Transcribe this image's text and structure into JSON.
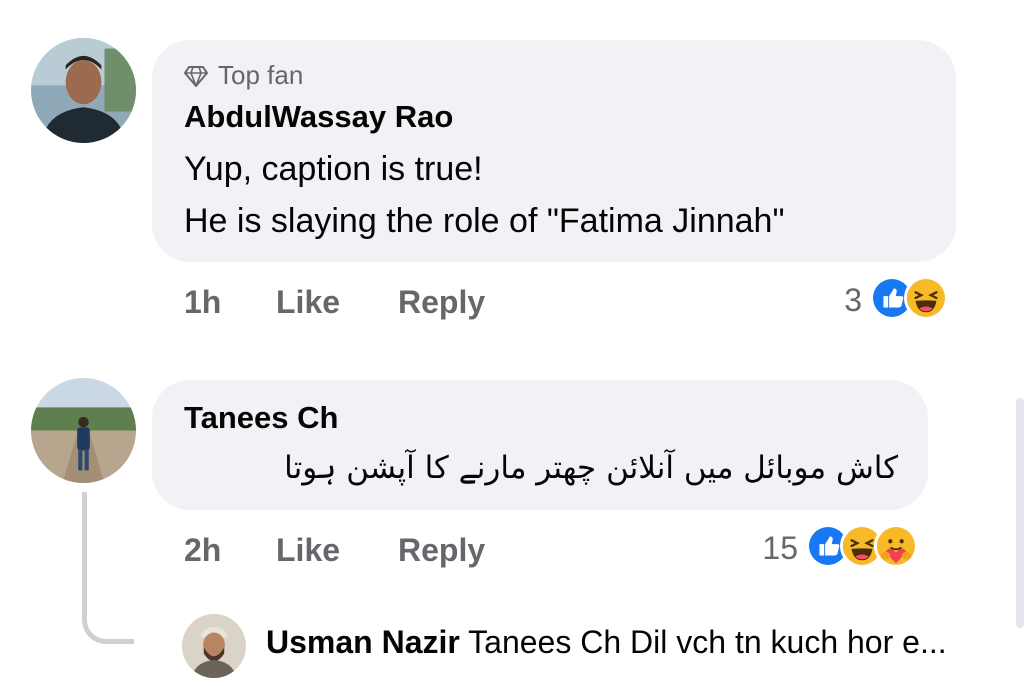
{
  "comments": [
    {
      "badge": "Top fan",
      "author": "AbdulWassay Rao",
      "lines": [
        "Yup, caption is true!",
        "He is slaying the role of \"Fatima Jinnah\""
      ],
      "time": "1h",
      "like_label": "Like",
      "reply_label": "Reply",
      "reaction_count": "3",
      "reactions": [
        "like-icon",
        "haha-icon"
      ]
    },
    {
      "author": "Tanees Ch",
      "lines": [
        "کاش موبائل میں آنلائن چھتر مارنے کا آپشن ہوتا"
      ],
      "time": "2h",
      "like_label": "Like",
      "reply_label": "Reply",
      "reaction_count": "15",
      "reactions": [
        "like-icon",
        "haha-icon",
        "care-icon"
      ]
    }
  ],
  "reply_preview": {
    "author": "Usman Nazir",
    "text": "Tanees Ch Dil vch tn kuch hor e..."
  },
  "colors": {
    "bubble": "#f0f2f5",
    "secondary_text": "#65676b",
    "like_blue": "#1877f2",
    "emoji_yellow": "#f7b928"
  }
}
